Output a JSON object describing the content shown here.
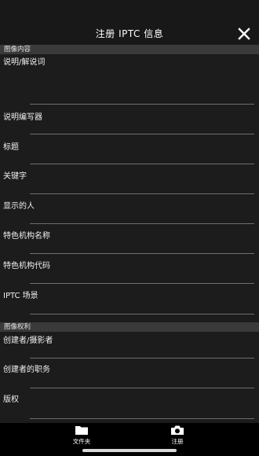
{
  "header": {
    "title": "注册 IPTC 信息",
    "close_icon": "close-icon"
  },
  "sections": [
    {
      "label": "图像内容",
      "fields": [
        "说明/解说词",
        "说明编写器",
        "标题",
        "关键字",
        "显示的人",
        "特色机构名称",
        "特色机构代码",
        "IPTC 场景"
      ]
    },
    {
      "label": "图像权利",
      "fields": [
        "创建者/摄影者",
        "创建者的职务",
        "版权"
      ]
    }
  ],
  "tabs": [
    {
      "label": "文件夹",
      "icon": "folder-icon"
    },
    {
      "label": "注册",
      "icon": "camera-icon"
    }
  ]
}
